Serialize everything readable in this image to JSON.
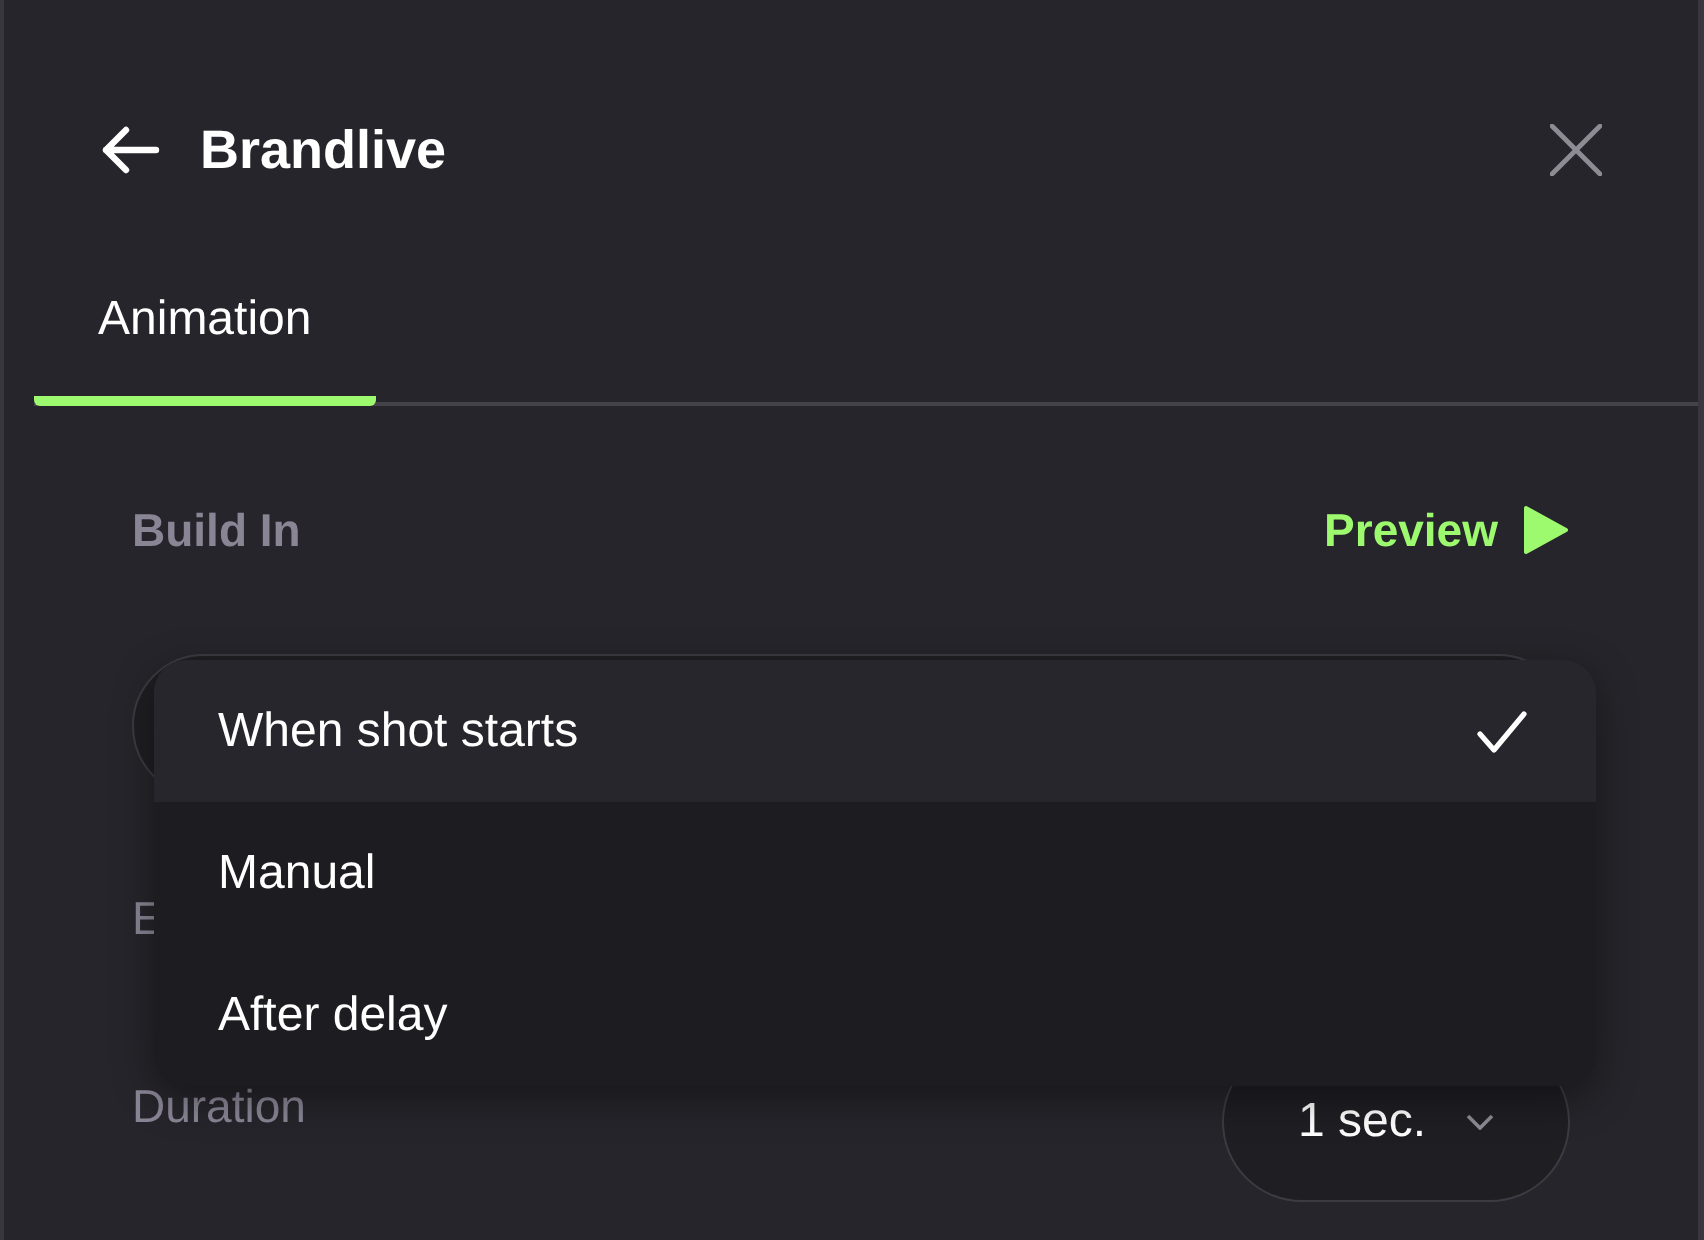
{
  "header": {
    "title": "Brandlive"
  },
  "tabs": [
    {
      "label": "Animation",
      "selected": true
    }
  ],
  "section": {
    "title": "Build In",
    "preview": "Preview"
  },
  "rows": [
    {
      "kind": "select"
    },
    {
      "kind": "label",
      "label": "E"
    },
    {
      "kind": "field",
      "label": "Duration",
      "value": "1 sec."
    }
  ],
  "menu": [
    {
      "label": "When shot starts",
      "selected": true
    },
    {
      "label": "Manual",
      "selected": false
    },
    {
      "label": "After delay",
      "selected": false
    }
  ]
}
